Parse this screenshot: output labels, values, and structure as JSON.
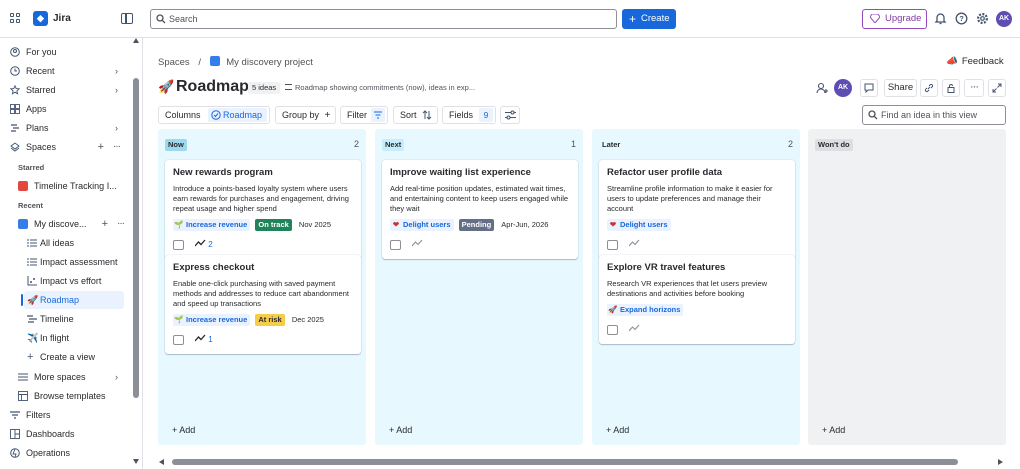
{
  "topbar": {
    "app_name": "Jira",
    "search_placeholder": "Search",
    "create_label": "Create",
    "upgrade_label": "Upgrade",
    "avatar_initials": "AK"
  },
  "sidebar": {
    "for_you": "For you",
    "recent": "Recent",
    "starred": "Starred",
    "apps": "Apps",
    "plans": "Plans",
    "spaces": "Spaces",
    "starred_section": "Starred",
    "starred_item": "Timeline Tracking I...",
    "recent_section": "Recent",
    "project": "My discove...",
    "sub_items": [
      "All ideas",
      "Impact assessment",
      "Impact vs effort",
      "Roadmap",
      "Timeline",
      "In flight",
      "Create a view"
    ],
    "more_spaces": "More spaces",
    "browse_templates": "Browse templates",
    "filters": "Filters",
    "dashboards": "Dashboards",
    "operations": "Operations"
  },
  "breadcrumb": {
    "spaces": "Spaces",
    "separator": "/",
    "project": "My discovery project"
  },
  "feedback_label": "Feedback",
  "page": {
    "title": "Roadmap",
    "ideas_count": "5 ideas",
    "description": "Roadmap showing commitments (now), ideas in exp...",
    "share_label": "Share",
    "avatar_initials": "AK"
  },
  "toolbar": {
    "columns": "Columns",
    "roadmap": "Roadmap",
    "group_by": "Group by",
    "filter": "Filter",
    "sort": "Sort",
    "fields": "Fields",
    "fields_count": "9",
    "find_placeholder": "Find an idea in this view"
  },
  "columns": [
    {
      "name": "Now",
      "count": "2",
      "add_label": "+ Add",
      "cards": [
        {
          "title": "New rewards program",
          "description": "Introduce a points-based loyalty system where users earn rewards for purchases and engagement, driving repeat usage and higher spend",
          "goal": "Increase revenue",
          "status": "On track",
          "date": "Nov 2025",
          "trend_count": "2"
        },
        {
          "title": "Express checkout",
          "description": "Enable one-click purchasing with saved payment methods and addresses to reduce cart abandonment and speed up transactions",
          "goal": "Increase revenue",
          "status": "At risk",
          "date": "Dec 2025",
          "trend_count": "1"
        }
      ]
    },
    {
      "name": "Next",
      "count": "1",
      "add_label": "+ Add",
      "cards": [
        {
          "title": "Improve waiting list experience",
          "description": "Add real-time position updates, estimated wait times, and entertaining content to keep users engaged while they wait",
          "goal": "Delight users",
          "status": "Pending",
          "date": "Apr-Jun, 2026"
        }
      ]
    },
    {
      "name": "Later",
      "count": "2",
      "add_label": "+ Add",
      "cards": [
        {
          "title": "Refactor user profile data",
          "description": "Streamline profile information to make it easier for users to update preferences and manage their account",
          "goal": "Delight users"
        },
        {
          "title": "Explore VR travel features",
          "description": "Research VR experiences that let users preview destinations and activities before booking",
          "goal": "Expand horizons"
        }
      ]
    },
    {
      "name": "Won't do",
      "add_label": "+ Add"
    }
  ],
  "colors": {
    "brand_blue": "#1868db",
    "on_track": "#1f845a",
    "at_risk": "#f5cd47",
    "pending": "#626f86",
    "column_bg": "#e7f9ff",
    "upgrade_purple": "#964ac0",
    "avatar_purple": "#5e4db2"
  }
}
